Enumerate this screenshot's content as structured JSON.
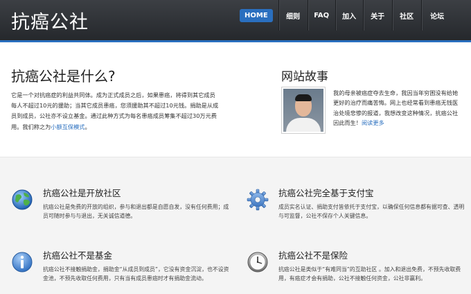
{
  "header": {
    "logo": "抗癌公社",
    "nav": [
      {
        "label": "HOME",
        "active": true
      },
      {
        "label": "细则"
      },
      {
        "label": "FAQ"
      },
      {
        "label": "加入"
      },
      {
        "label": "关于"
      },
      {
        "label": "社区"
      },
      {
        "label": "论坛"
      }
    ]
  },
  "about": {
    "title": "抗癌公社是什么?",
    "text": "它是一个对抗癌症的利益共同体。成为正式成员之后，如果患癌，将得到其它成员每人不超过10元的援助；当其它成员患癌，您须援助其不超过10元钱。捐助是从成员到成员，公社亦不设立基金。通过此种方式为每名患癌成员筹集不超过30万元费用。我们称之为",
    "link": "小额互保模式",
    "tail": "。"
  },
  "story": {
    "title": "网站故事",
    "text": "我的母亲被癌症夺去生命，我因当年穷困没有给她更好的治疗而痛苦悔。网上也经常看到患癌无钱医治处境悲惨的报道，我想改变这种情况，抗癌公社因此而生！",
    "link": "阅读更多"
  },
  "features": [
    {
      "icon": "globe-icon",
      "title": "抗癌公社是开放社区",
      "text": "抗癌公社是免费的开放的组织，参与和退出都是自愿自发，没有任何费用；成员可随时参与与退出，无关诚信道德。"
    },
    {
      "icon": "gear-icon",
      "title": "抗癌公社完全基于支付宝",
      "text": "成员实名认证、捐助支付皆依托于支付宝，以确保任何信息都有据可查、透明与可监督，公社不保存个人关键信息。"
    },
    {
      "icon": "info-icon",
      "title": "抗癌公社不是基金",
      "text": "抗癌公社不接触捐助金，捐助金“从成员到成员”，它没有资金沉淀，也不设资金池，不预先收取任何费用，只有当有成员患癌时才有捐助金流动。"
    },
    {
      "icon": "clock-icon",
      "title": "抗癌公社不是保险",
      "text": "抗癌公社是类似于“有难同当”的互助社区 。加入和退出免费，不预先收取费用，有癌症才会有捐助，公社不接触任何资金，公社非赢利。"
    }
  ]
}
